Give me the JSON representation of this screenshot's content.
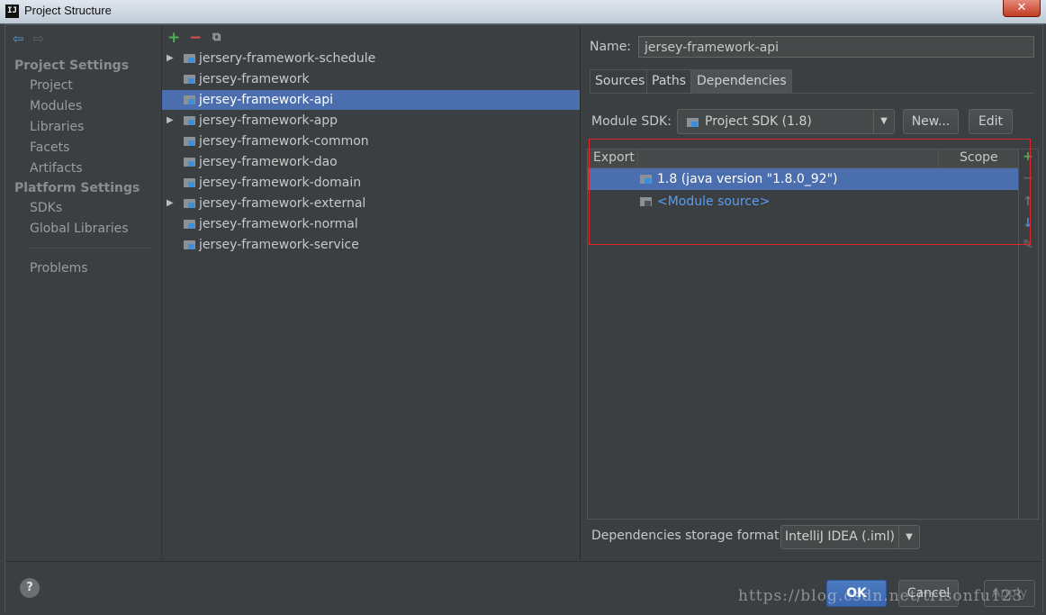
{
  "window": {
    "title": "Project Structure",
    "app_icon_text": "IJ",
    "close_label": "✕"
  },
  "sidebar": {
    "section_project_settings": "Project Settings",
    "project_items": [
      "Project",
      "Modules",
      "Libraries",
      "Facets",
      "Artifacts"
    ],
    "section_platform_settings": "Platform Settings",
    "platform_items": [
      "SDKs",
      "Global Libraries"
    ],
    "problems": "Problems"
  },
  "modules": {
    "toolbar": {
      "add": "+",
      "remove": "−",
      "copy": "⧉"
    },
    "items": [
      {
        "label": "jersery-framework-schedule",
        "expandable": true,
        "selected": false
      },
      {
        "label": "jersey-framework",
        "expandable": false,
        "selected": false
      },
      {
        "label": "jersey-framework-api",
        "expandable": false,
        "selected": true
      },
      {
        "label": "jersey-framework-app",
        "expandable": true,
        "selected": false
      },
      {
        "label": "jersey-framework-common",
        "expandable": false,
        "selected": false
      },
      {
        "label": "jersey-framework-dao",
        "expandable": false,
        "selected": false
      },
      {
        "label": "jersey-framework-domain",
        "expandable": false,
        "selected": false
      },
      {
        "label": "jersey-framework-external",
        "expandable": true,
        "selected": false
      },
      {
        "label": "jersey-framework-normal",
        "expandable": false,
        "selected": false
      },
      {
        "label": "jersey-framework-service",
        "expandable": false,
        "selected": false
      }
    ]
  },
  "details": {
    "name_label": "Name:",
    "name_value": "jersey-framework-api",
    "tabs": [
      "Sources",
      "Paths",
      "Dependencies"
    ],
    "active_tab": "Dependencies",
    "module_sdk_label": "Module SDK:",
    "module_sdk_value": "Project SDK (1.8)",
    "new_button": "New...",
    "edit_button": "Edit",
    "table": {
      "col_export": "Export",
      "col_scope": "Scope",
      "rows": [
        {
          "text": "1.8 (java version \"1.8.0_92\")",
          "selected": true
        },
        {
          "text": "<Module source>",
          "selected": false
        }
      ]
    },
    "storage_label": "Dependencies storage format:",
    "storage_value": "IntelliJ IDEA (.iml)"
  },
  "footer": {
    "help": "?",
    "ok": "OK",
    "cancel": "Cancel",
    "apply": "Apply"
  },
  "watermark": "https://blog.csdn.net/trisonfu123",
  "colors": {
    "selection": "#4b6eaf",
    "highlight_box": "#e0262b",
    "link": "#589df6"
  }
}
